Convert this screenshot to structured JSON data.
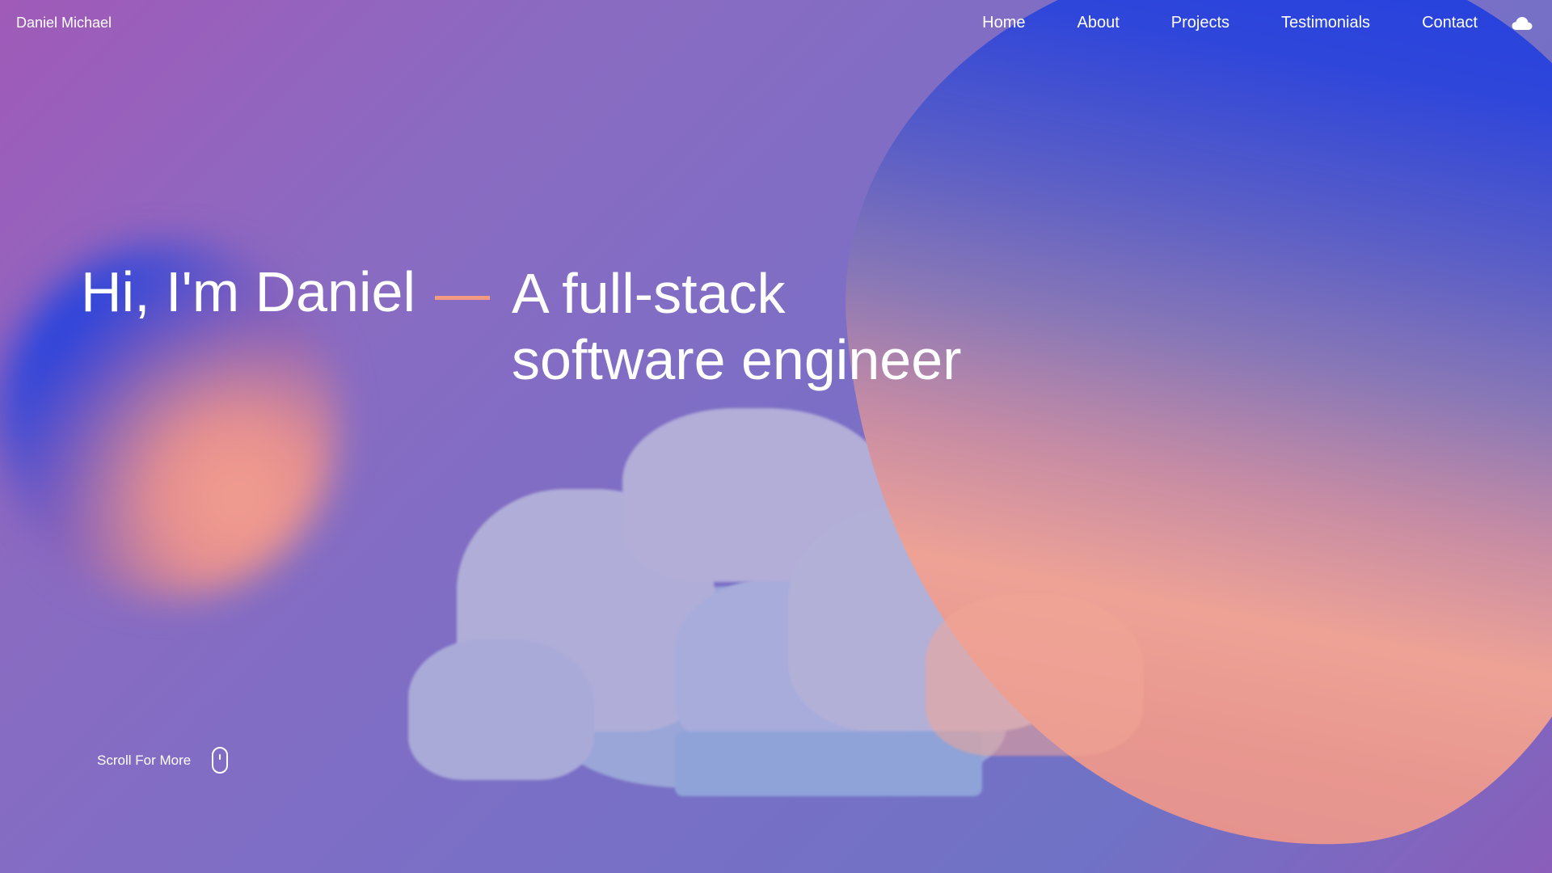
{
  "brand": {
    "name": "Daniel Michael"
  },
  "nav": {
    "items": [
      {
        "label": "Home"
      },
      {
        "label": "About"
      },
      {
        "label": "Projects"
      },
      {
        "label": "Testimonials"
      },
      {
        "label": "Contact"
      }
    ],
    "theme_toggle_icon": "cloud-icon"
  },
  "hero": {
    "greeting": "Hi, I'm Daniel",
    "role_line1": "A full-stack",
    "role_line2": "software engineer"
  },
  "scroll_hint": {
    "label": "Scroll For More",
    "icon": "mouse-icon"
  },
  "colors": {
    "accent_dash": "#f39a83",
    "blob_blue": "#1e3ee0",
    "blob_peach": "#eea296",
    "background_purple": "#7a6fc6"
  }
}
